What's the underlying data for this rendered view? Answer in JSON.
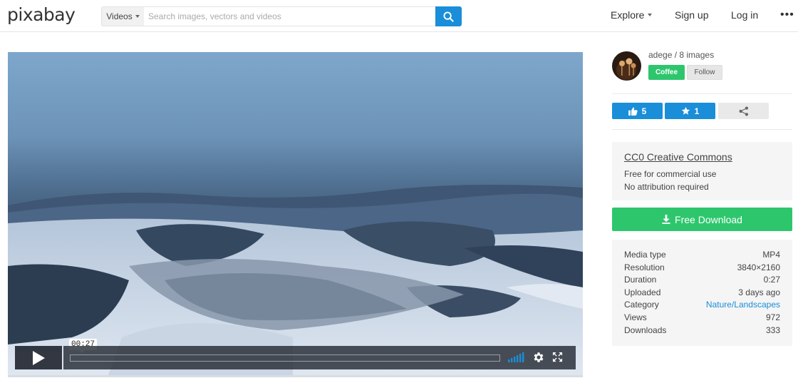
{
  "header": {
    "logo": "pixabay",
    "search_type": "Videos",
    "search_placeholder": "Search images, vectors and videos",
    "nav": {
      "explore": "Explore",
      "signup": "Sign up",
      "login": "Log in",
      "more": "•••"
    }
  },
  "video": {
    "time": "00:27"
  },
  "user": {
    "line": "adege / 8 images",
    "coffee": "Coffee",
    "follow": "Follow"
  },
  "actions": {
    "likes": "5",
    "favorites": "1"
  },
  "license": {
    "title": "CC0 Creative Commons",
    "line1": "Free for commercial use",
    "line2": "No attribution required"
  },
  "download": {
    "label": "Free Download"
  },
  "info": [
    {
      "label": "Media type",
      "value": "MP4"
    },
    {
      "label": "Resolution",
      "value": "3840×2160"
    },
    {
      "label": "Duration",
      "value": "0:27"
    },
    {
      "label": "Uploaded",
      "value": "3 days ago"
    },
    {
      "label": "Category",
      "value": "Nature/Landscapes"
    },
    {
      "label": "Views",
      "value": "972"
    },
    {
      "label": "Downloads",
      "value": "333"
    }
  ],
  "colors": {
    "accent_blue": "#1a8ed8",
    "accent_green": "#2ec66d"
  }
}
